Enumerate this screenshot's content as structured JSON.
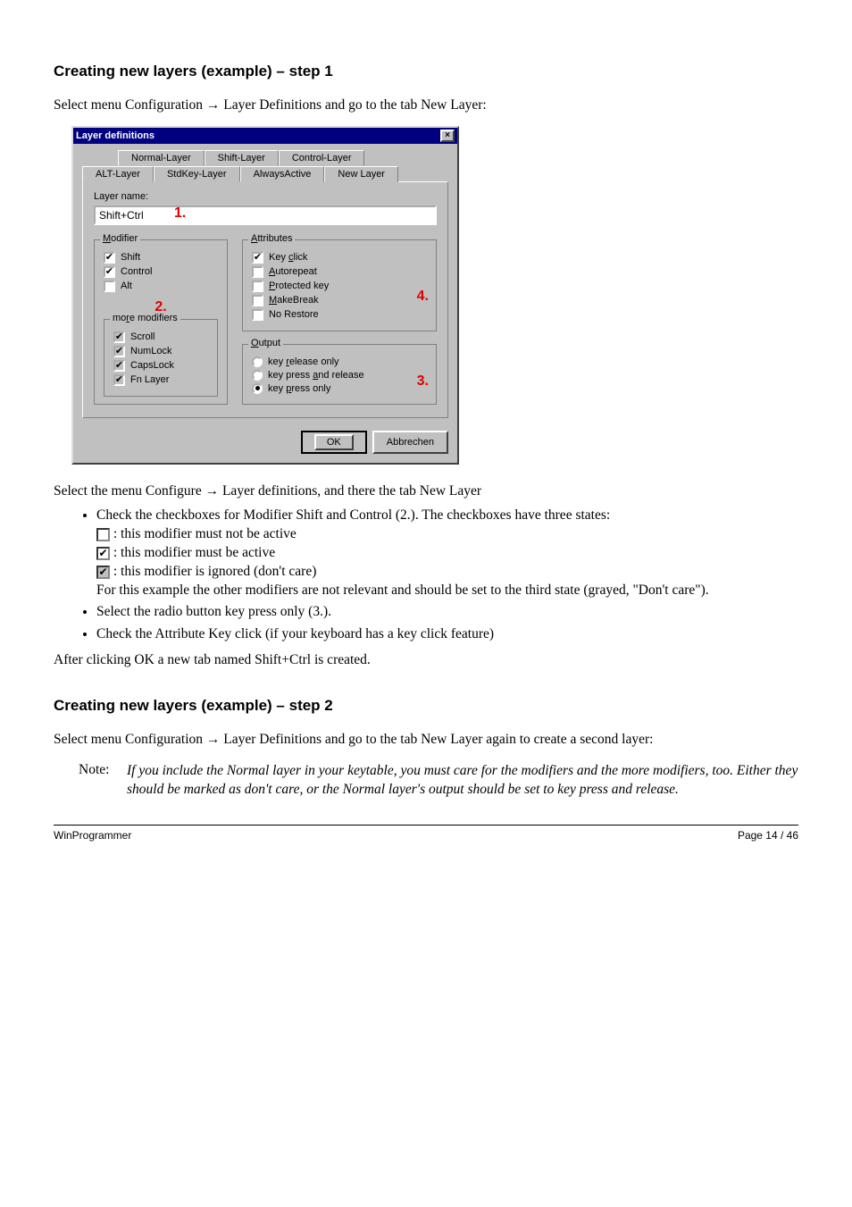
{
  "doc": {
    "h1": "Creating new layers (example) – step 1",
    "p1a": "Select menu Configuration ",
    "p1b": " Layer Definitions and go to the tab New Layer:",
    "dialog": {
      "title": "Layer definitions",
      "close_glyph": "×",
      "tabs_row1": [
        "Normal-Layer",
        "Shift-Layer",
        "Control-Layer"
      ],
      "tabs_row2": [
        "ALT-Layer",
        "StdKey-Layer",
        "AlwaysActive",
        "New Layer"
      ],
      "layer_name_label": "Layer name:",
      "layer_name_value": "Shift+Ctrl",
      "annot1": "1.",
      "modifier": {
        "legend": "Modifier",
        "items": [
          {
            "label": "Shift",
            "checked": true
          },
          {
            "label": "Control",
            "checked": true
          },
          {
            "label": "Alt",
            "checked": false
          }
        ],
        "annot2": "2.",
        "more_legend": "more modifiers",
        "more_items": [
          {
            "label": "Scroll"
          },
          {
            "label": "NumLock"
          },
          {
            "label": "CapsLock"
          },
          {
            "label": "Fn Layer"
          }
        ]
      },
      "attributes": {
        "legend": "Attributes",
        "items": [
          {
            "label": "Key click",
            "checked": true
          },
          {
            "label": "Autorepeat",
            "checked": false
          },
          {
            "label": "Protected key",
            "checked": false
          },
          {
            "label": "MakeBreak",
            "checked": false
          },
          {
            "label": "No Restore",
            "checked": false
          }
        ],
        "annot4": "4."
      },
      "output": {
        "legend": "Output",
        "items": [
          {
            "label": "key release only",
            "selected": false
          },
          {
            "label": "key press and release",
            "selected": false
          },
          {
            "label": "key press only",
            "selected": true
          }
        ],
        "annot3": "3."
      },
      "ok": "OK",
      "cancel": "Abbrechen"
    },
    "steps_intro_a": "Select the menu Configure ",
    "steps_intro_b": " Layer definitions, and there the tab New Layer",
    "bullets": [
      {
        "lead": "Check the checkboxes for Modifier Shift and Control (2.). The checkboxes have three states:",
        "sub": [
          {
            "state": "unchecked",
            "txt": ": this modifier must not be active"
          },
          {
            "state": "checked",
            "txt": ": this modifier must be active"
          },
          {
            "state": "greyed",
            "txt": ": this modifier is ignored (don't care)"
          }
        ],
        "tail": "For this example the other modifiers are not relevant and should be set to the third state (grayed, \"Don't care\")."
      },
      {
        "txt": "Select the radio button key press only (3.)."
      },
      {
        "txt": "Check the Attribute Key click (if your keyboard has a key click feature)"
      }
    ],
    "after": "After clicking OK a new tab named Shift+Ctrl is created.",
    "h2": "Creating new layers (example) – step 2",
    "p2a": "Select menu Configuration ",
    "p2b": " Layer Definitions and go to the tab New Layer again to create a second layer:",
    "note_lbl": "Note:",
    "note_txt": "If you include the Normal layer in your keytable, you must care for the modifiers and the more modifiers, too. Either they should be marked as don't care, or the Normal layer's output should be set to key press and release.",
    "footer_left": "WinProgrammer",
    "footer_right": "Page 14 / 46"
  }
}
